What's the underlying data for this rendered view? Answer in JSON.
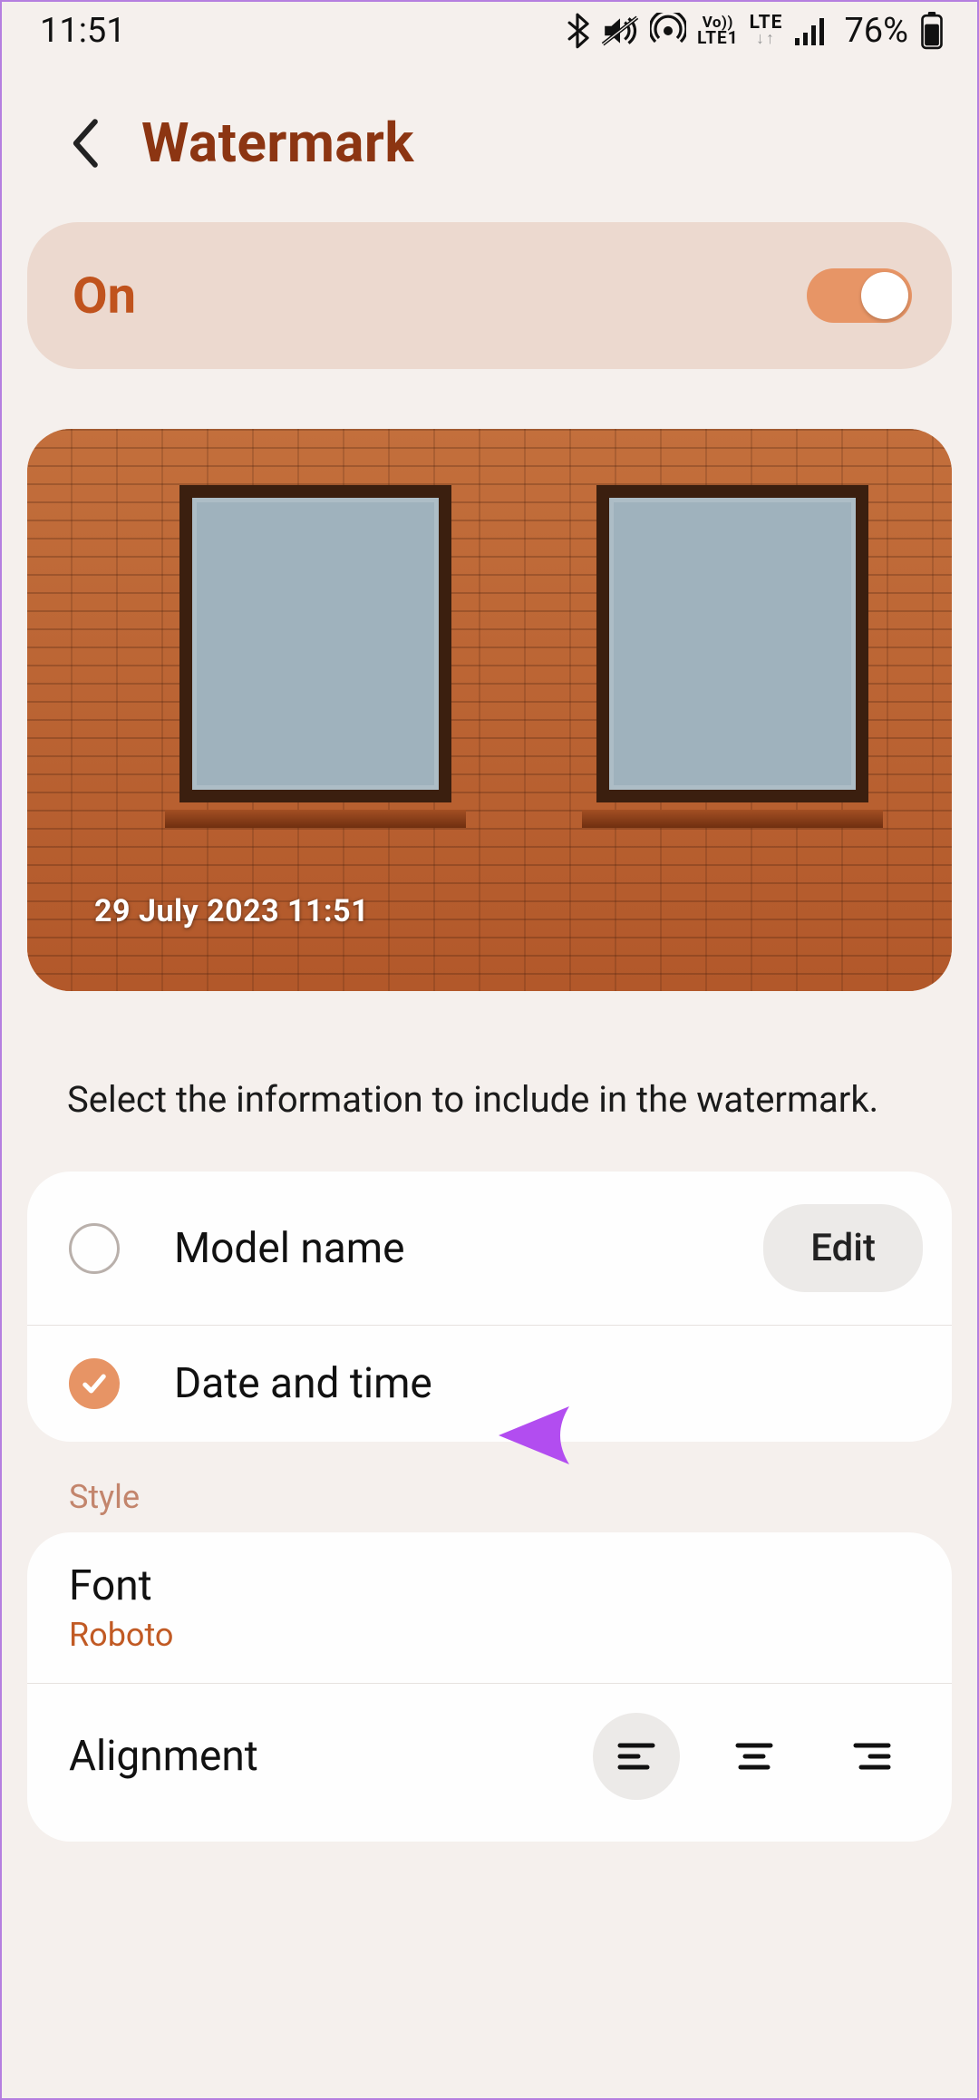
{
  "status": {
    "time": "11:51",
    "battery_pct": "76%"
  },
  "header": {
    "title": "Watermark"
  },
  "toggle": {
    "label": "On",
    "state": "on"
  },
  "preview": {
    "watermark_text": "29 July 2023 11:51"
  },
  "helper_text": "Select the information to include in the watermark.",
  "options": [
    {
      "label": "Model name",
      "checked": false,
      "edit_label": "Edit"
    },
    {
      "label": "Date and time",
      "checked": true
    }
  ],
  "style_section": {
    "heading": "Style",
    "font": {
      "title": "Font",
      "value": "Roboto"
    },
    "alignment": {
      "title": "Alignment",
      "selected": "left"
    }
  }
}
